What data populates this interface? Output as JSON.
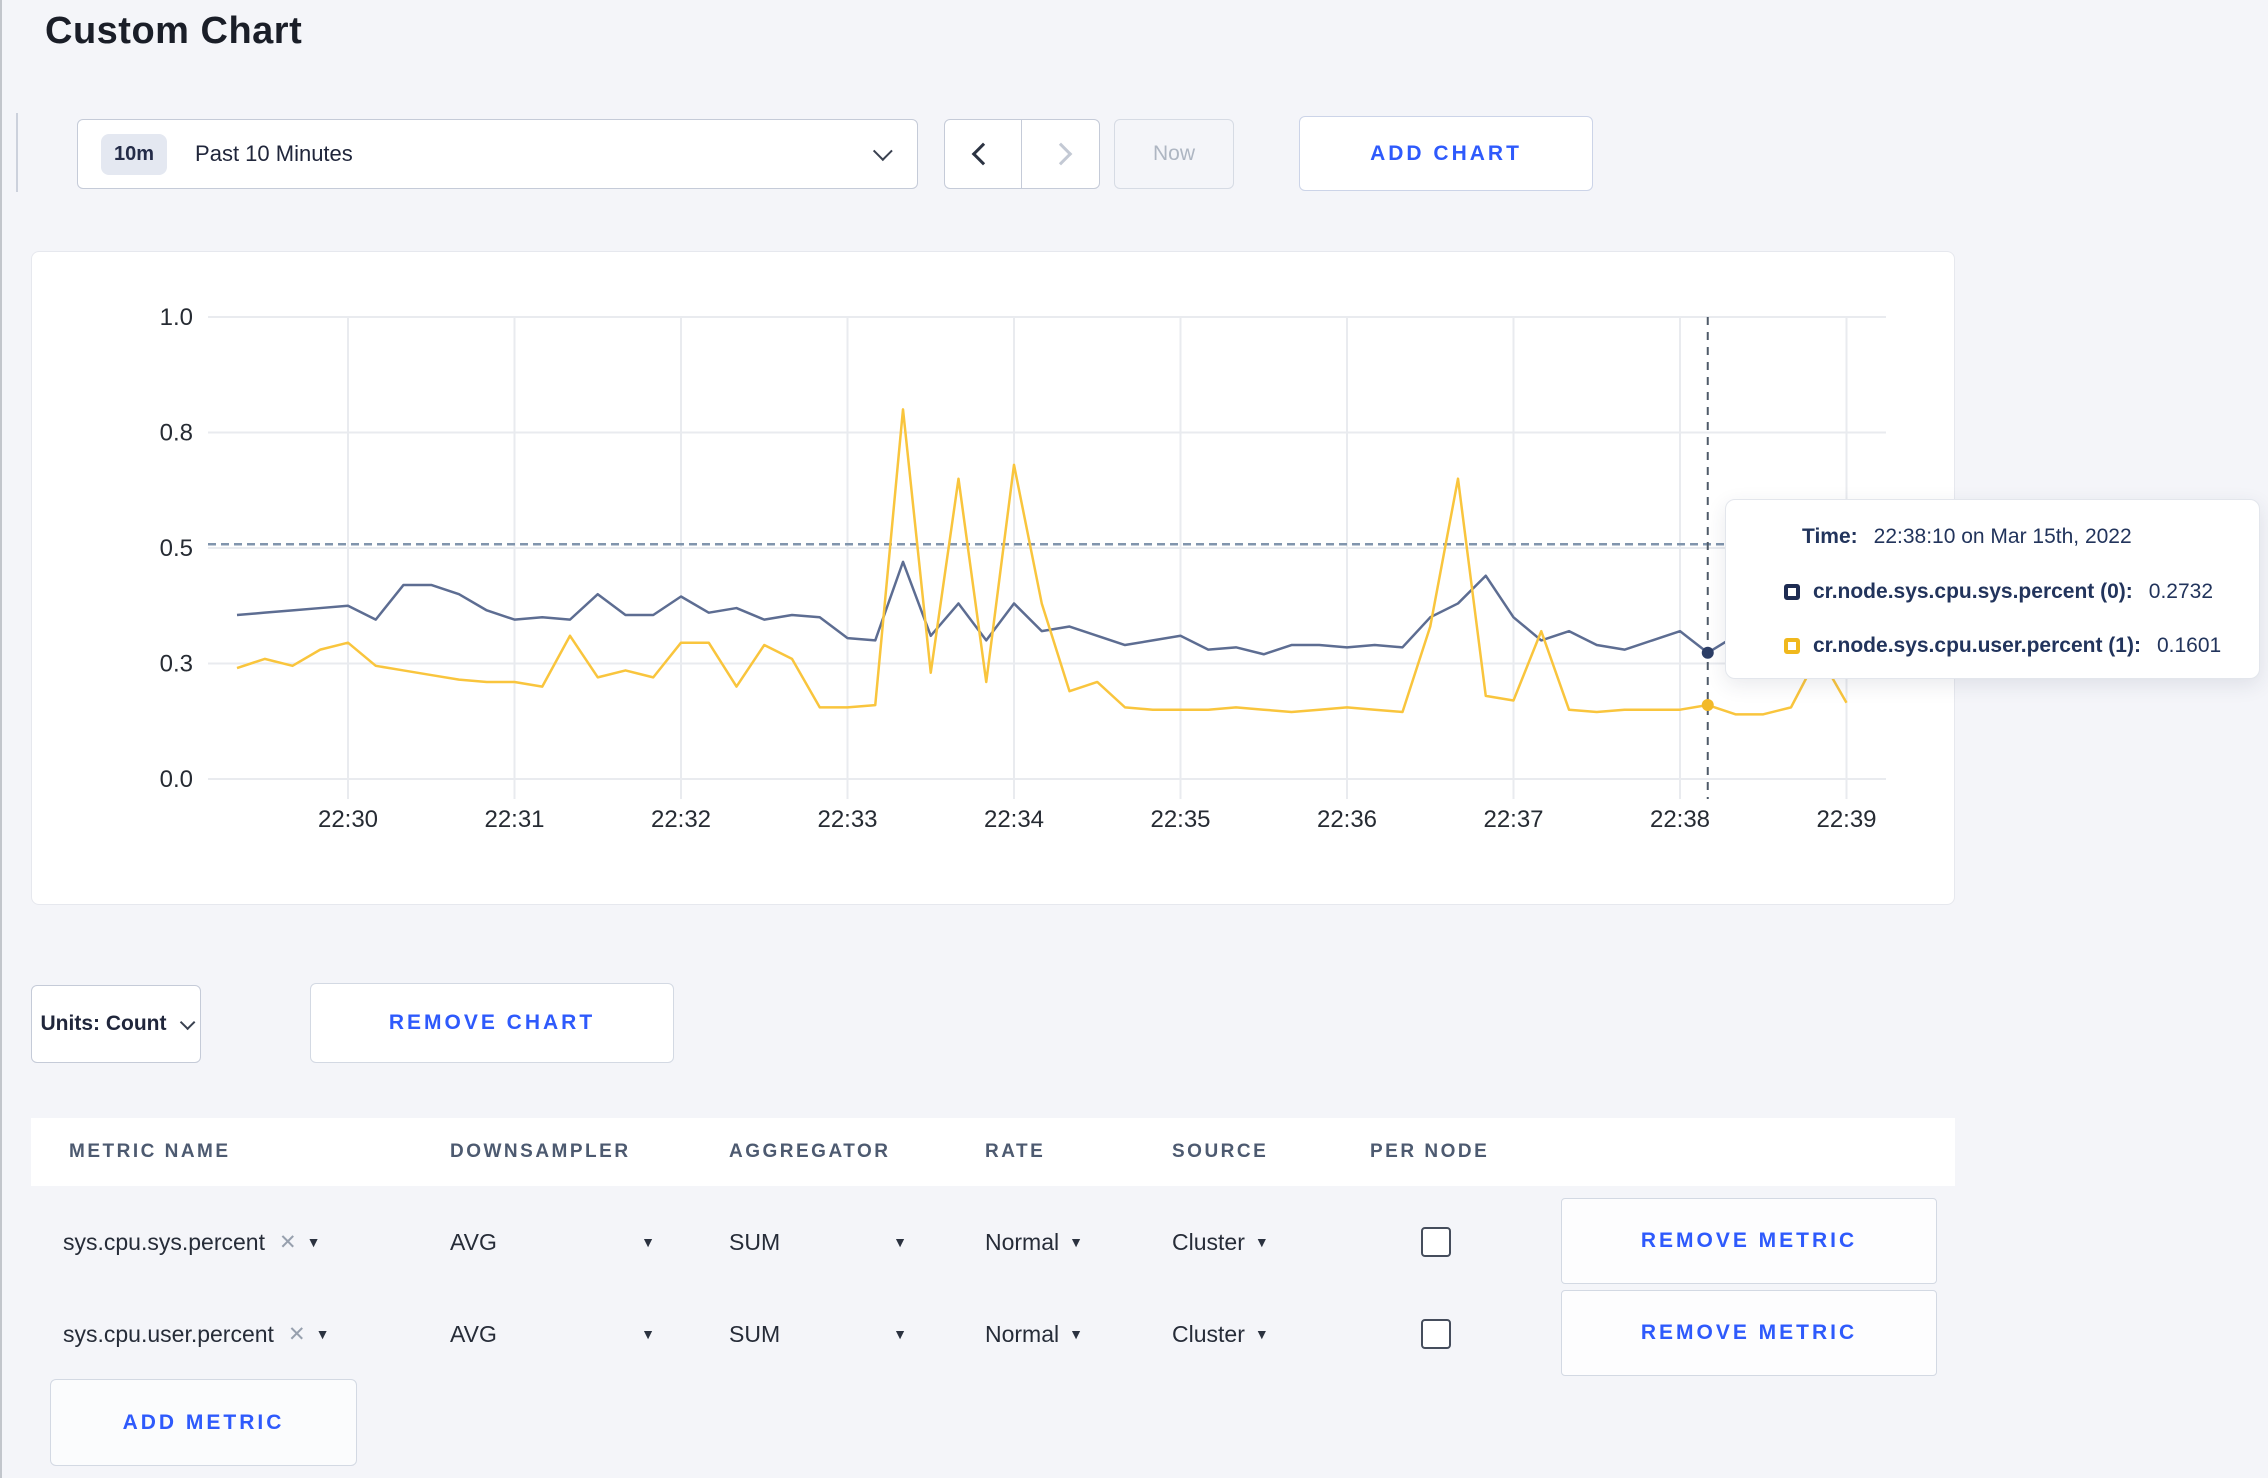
{
  "page": {
    "title": "Custom Chart"
  },
  "toolbar": {
    "time_badge": "10m",
    "time_label": "Past 10 Minutes",
    "now_label": "Now",
    "add_chart_label": "ADD CHART"
  },
  "tooltip": {
    "time_label": "Time:",
    "time_value": "22:38:10 on Mar 15th, 2022",
    "series": [
      {
        "label": "cr.node.sys.cpu.sys.percent (0):",
        "value": "0.2732",
        "swatch_color": "#1e2c52"
      },
      {
        "label": "cr.node.sys.cpu.user.percent (1):",
        "value": "0.1601",
        "swatch_color": "#f0b81d"
      }
    ]
  },
  "chart_controls": {
    "units_label": "Units: Count",
    "remove_chart_label": "REMOVE CHART"
  },
  "metrics_table": {
    "headers": [
      "METRIC NAME",
      "DOWNSAMPLER",
      "AGGREGATOR",
      "RATE",
      "SOURCE",
      "PER NODE"
    ],
    "remove_metric_label": "REMOVE METRIC",
    "add_metric_label": "ADD METRIC",
    "rows": [
      {
        "metric": "sys.cpu.sys.percent",
        "downsampler": "AVG",
        "aggregator": "SUM",
        "rate": "Normal",
        "source": "Cluster",
        "per_node_checked": false
      },
      {
        "metric": "sys.cpu.user.percent",
        "downsampler": "AVG",
        "aggregator": "SUM",
        "rate": "Normal",
        "source": "Cluster",
        "per_node_checked": false
      }
    ]
  },
  "chart_data": {
    "type": "line",
    "title": "",
    "xlabel": "",
    "ylabel": "",
    "ylim": [
      0,
      1
    ],
    "grid": true,
    "x_tick_labels": [
      "22:30",
      "22:31",
      "22:32",
      "22:33",
      "22:34",
      "22:35",
      "22:36",
      "22:37",
      "22:38",
      "22:39"
    ],
    "y_tick_labels": [
      "1.0",
      "0.8",
      "0.5",
      "0.3",
      "0.0"
    ],
    "y_tick_values": [
      1.0,
      0.75,
      0.5,
      0.25,
      0.0
    ],
    "start_offset_sec": -40,
    "step_sec": 10,
    "threshold_value": 0.508,
    "hover": {
      "index": 53,
      "time": "22:38:10"
    },
    "grid_color": "#e9ebef",
    "threshold_color": "#8195ad",
    "crosshair_color": "#4f5a68",
    "tick_text_color": "#262b33",
    "series": [
      {
        "name": "cr.node.sys.cpu.sys.percent",
        "node": "(0)",
        "color": "#5d6d92",
        "dot_color": "#2c3e66",
        "hover_value": 0.2732,
        "values": [
          0.355,
          0.36,
          0.365,
          0.37,
          0.375,
          0.345,
          0.42,
          0.42,
          0.4,
          0.365,
          0.345,
          0.35,
          0.345,
          0.4,
          0.355,
          0.355,
          0.395,
          0.36,
          0.37,
          0.345,
          0.355,
          0.35,
          0.305,
          0.3,
          0.47,
          0.31,
          0.38,
          0.3,
          0.38,
          0.32,
          0.33,
          0.31,
          0.29,
          0.3,
          0.31,
          0.28,
          0.285,
          0.27,
          0.29,
          0.29,
          0.285,
          0.29,
          0.285,
          0.35,
          0.38,
          0.44,
          0.35,
          0.3,
          0.32,
          0.29,
          0.28,
          0.3,
          0.32,
          0.2732,
          0.31,
          0.29,
          0.3,
          0.3,
          0.3
        ]
      },
      {
        "name": "cr.node.sys.cpu.user.percent",
        "node": "(1)",
        "color": "#f9c53d",
        "dot_color": "#f2b929",
        "hover_value": 0.1601,
        "values": [
          0.24,
          0.26,
          0.245,
          0.28,
          0.295,
          0.245,
          0.235,
          0.225,
          0.215,
          0.21,
          0.21,
          0.2,
          0.31,
          0.22,
          0.235,
          0.22,
          0.295,
          0.295,
          0.2,
          0.29,
          0.26,
          0.155,
          0.155,
          0.16,
          0.8,
          0.23,
          0.65,
          0.21,
          0.68,
          0.38,
          0.19,
          0.21,
          0.155,
          0.15,
          0.15,
          0.15,
          0.155,
          0.15,
          0.145,
          0.15,
          0.155,
          0.15,
          0.145,
          0.33,
          0.65,
          0.18,
          0.17,
          0.32,
          0.15,
          0.145,
          0.15,
          0.15,
          0.15,
          0.1601,
          0.14,
          0.14,
          0.155,
          0.27,
          0.165
        ]
      }
    ]
  }
}
